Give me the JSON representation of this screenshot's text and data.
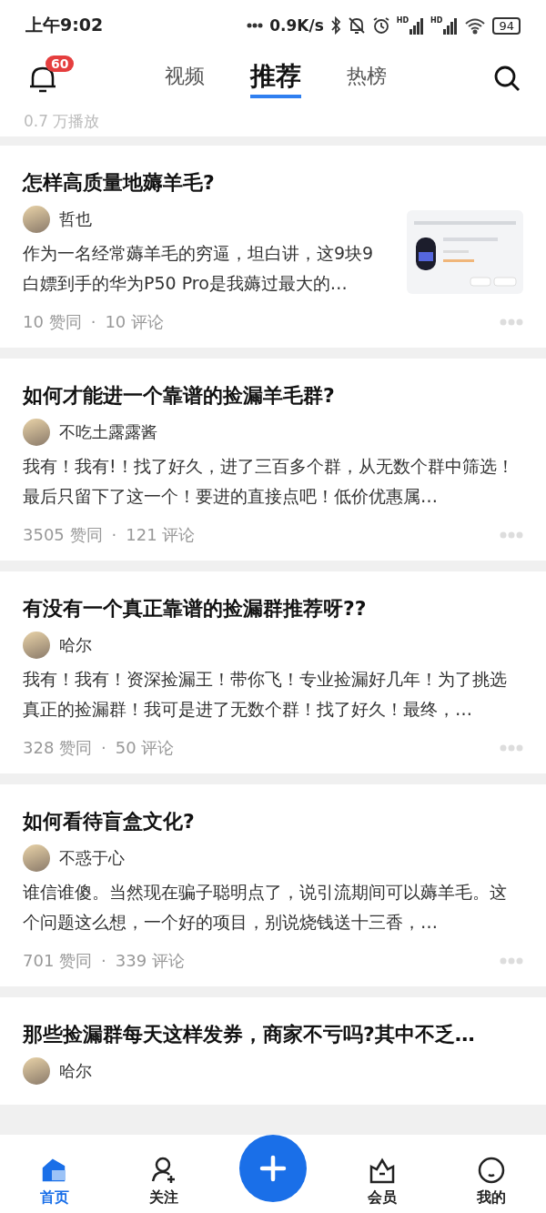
{
  "status_bar": {
    "time": "上午9:02",
    "speed": "0.9K/s",
    "signal_labels": [
      "HD",
      "HD"
    ],
    "battery": "94"
  },
  "header": {
    "notification_count": "60",
    "tabs": [
      {
        "label": "视频",
        "selected": false
      },
      {
        "label": "推荐",
        "selected": true
      },
      {
        "label": "热榜",
        "selected": false
      }
    ]
  },
  "previous_item": {
    "stats": "0.7 万播放"
  },
  "feed": [
    {
      "title": "怎样高质量地薅羊毛?",
      "author": "哲也",
      "excerpt": "作为一名经常薅羊毛的穷逼，坦白讲，这9块9白嫖到手的华为P50 Pro是我薅过最大的…",
      "likes": "10 赞同",
      "separator": "·",
      "comments": "10 评论"
    },
    {
      "title": "如何才能进一个靠谱的捡漏羊毛群?",
      "author": "不吃土露露酱",
      "excerpt": "我有！我有!！找了好久，进了三百多个群，从无数个群中筛选！最后只留下了这一个！要进的直接点吧！低价优惠属…",
      "likes": "3505 赞同",
      "separator": "·",
      "comments": "121 评论"
    },
    {
      "title": "有没有一个真正靠谱的捡漏群推荐呀??",
      "author": "哈尔",
      "excerpt": "我有！我有！资深捡漏王！带你飞！专业捡漏好几年！为了挑选真正的捡漏群！我可是进了无数个群！找了好久！最终，…",
      "likes": "328 赞同",
      "separator": "·",
      "comments": "50 评论"
    },
    {
      "title": "如何看待盲盒文化?",
      "author": "不惑于心",
      "excerpt": "谁信谁傻。当然现在骗子聪明点了，说引流期间可以薅羊毛。这个问题这么想，一个好的项目，别说烧钱送十三香，…",
      "likes": "701 赞同",
      "separator": "·",
      "comments": "339 评论"
    },
    {
      "title": "那些捡漏群每天这样发券，商家不亏吗?其中不乏…",
      "author": "哈尔"
    }
  ],
  "bottom_nav": [
    {
      "label": "首页",
      "selected": true,
      "kind": "home"
    },
    {
      "label": "关注",
      "selected": false,
      "kind": "follow"
    },
    {
      "kind": "create"
    },
    {
      "label": "会员",
      "selected": false,
      "kind": "vip"
    },
    {
      "label": "我的",
      "selected": false,
      "kind": "me"
    }
  ]
}
